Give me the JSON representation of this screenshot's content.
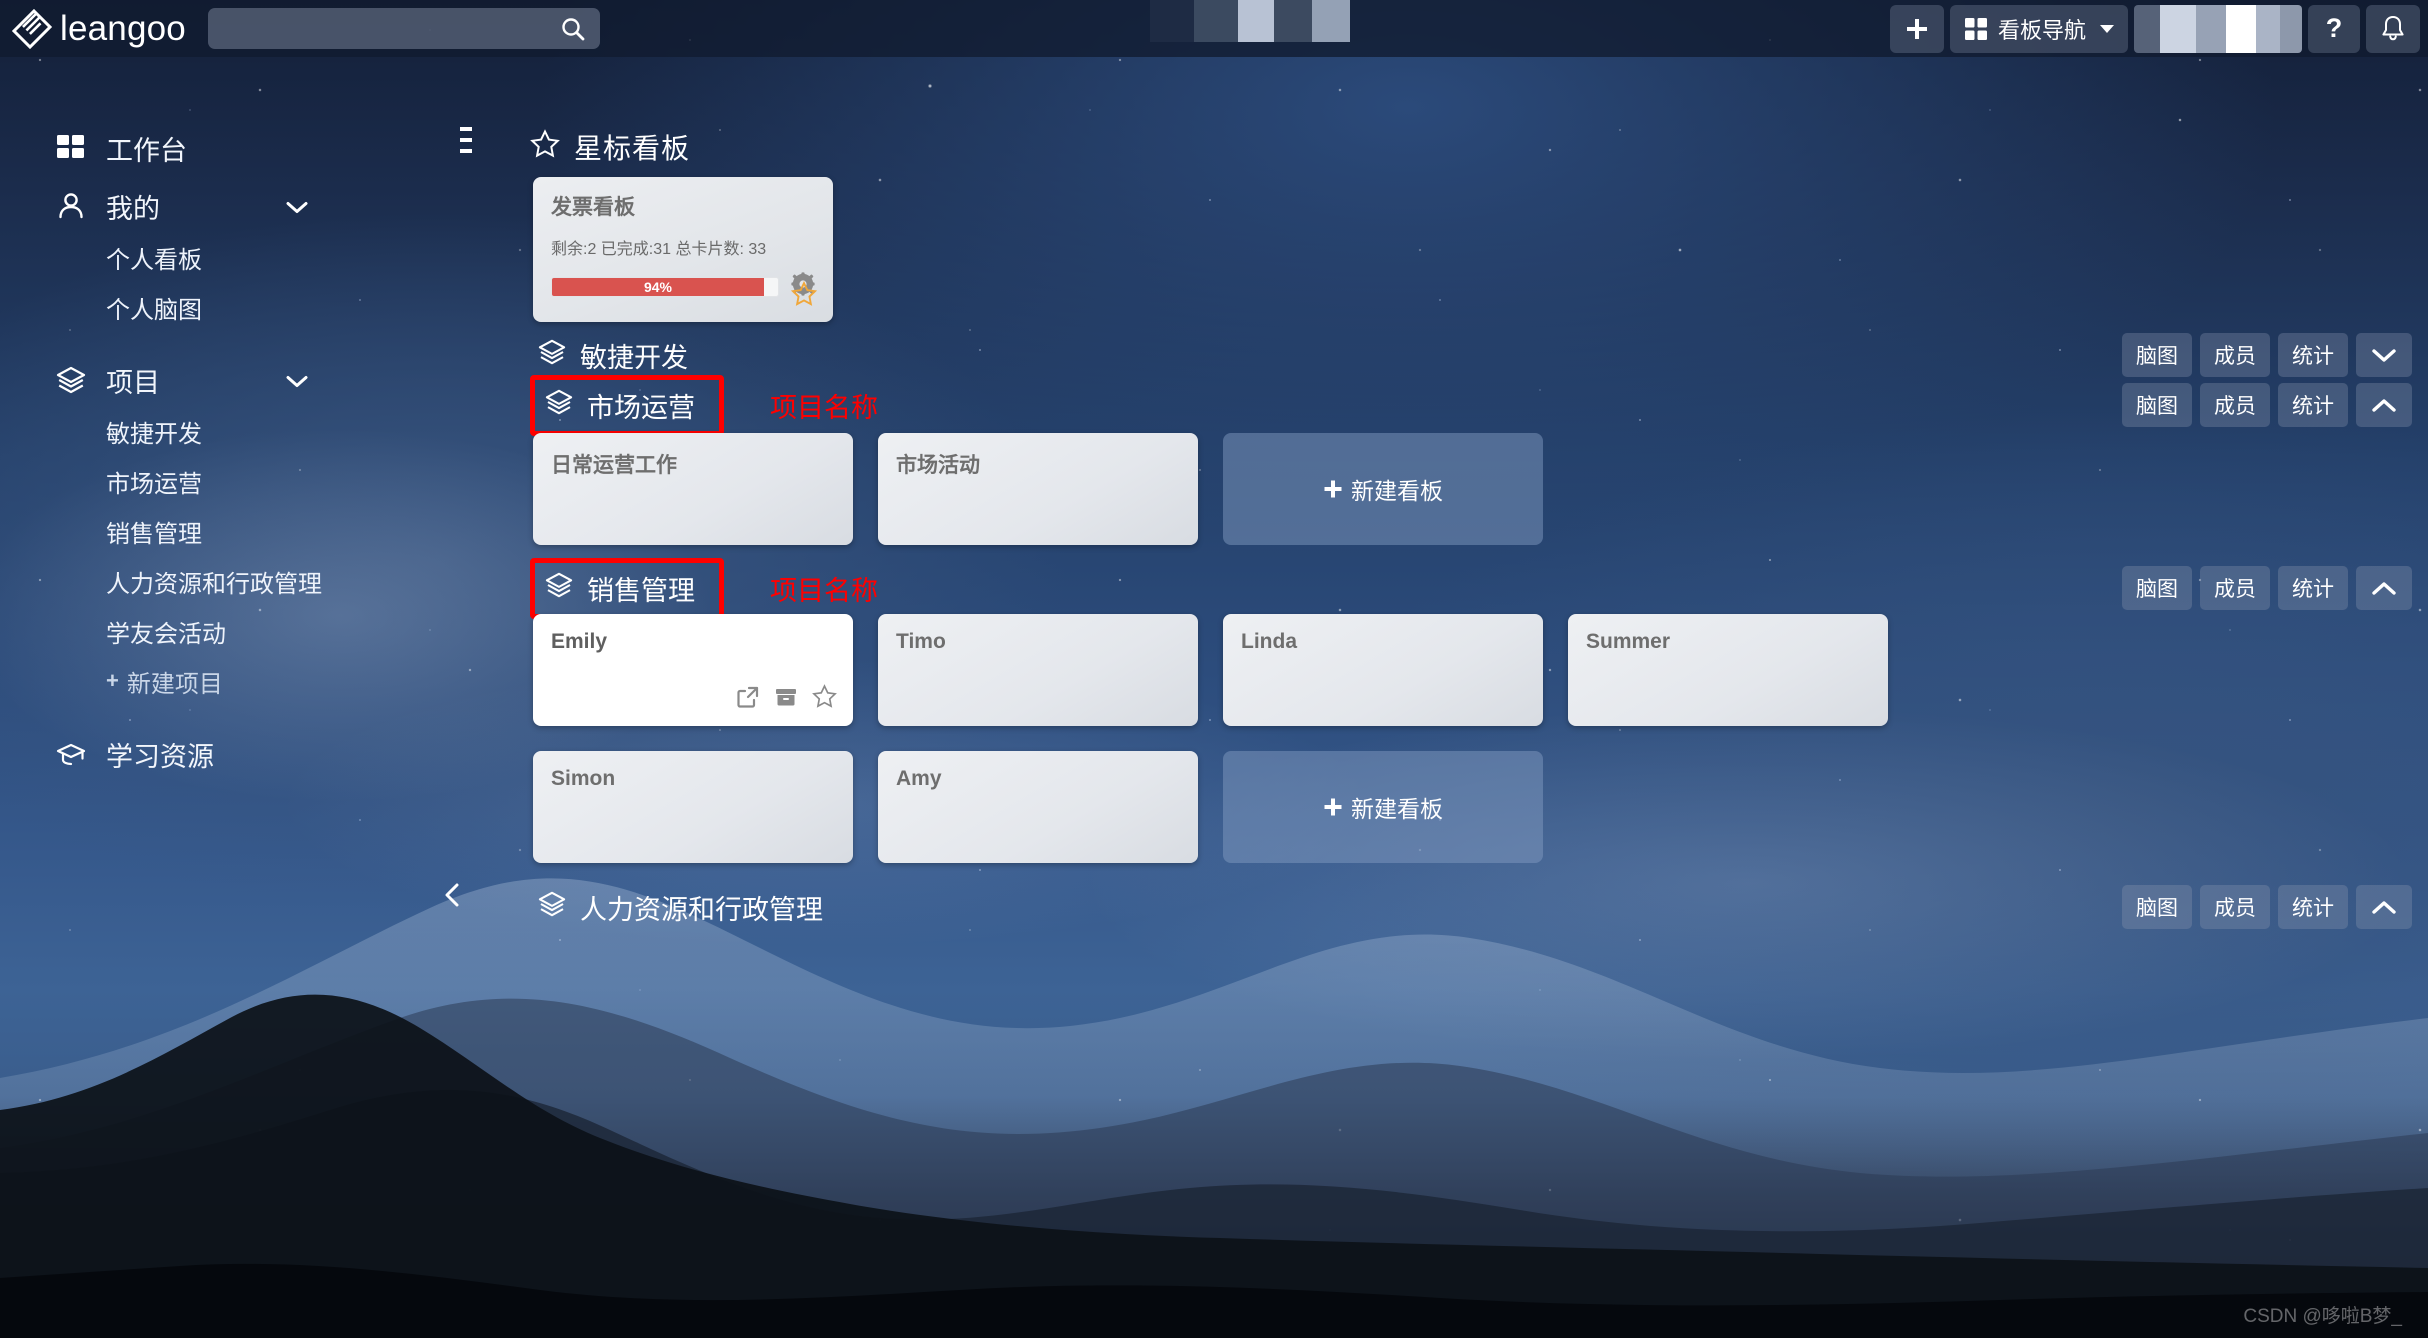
{
  "header": {
    "logo_text": "leangoo",
    "logo_icon": "leangoo-diamond-logo",
    "search_placeholder": "",
    "search_value": "",
    "search_icon": "search-icon",
    "add_button_label": "+",
    "apps_icon": "grid-apps-icon",
    "board_nav_label": "看板导航",
    "help_label": "?",
    "bell_icon": "bell-notification-icon"
  },
  "sidebar": {
    "workbench": {
      "label": "工作台",
      "icon": "grid-dashboard-icon"
    },
    "mine": {
      "label": "我的",
      "icon": "person-icon",
      "chevron": "chevron-down-icon"
    },
    "mine_children": [
      {
        "label": "个人看板"
      },
      {
        "label": "个人脑图"
      }
    ],
    "projects": {
      "label": "项目",
      "icon": "layers-icon",
      "chevron": "chevron-down-icon"
    },
    "project_children": [
      {
        "label": "敏捷开发"
      },
      {
        "label": "市场运营"
      },
      {
        "label": "销售管理"
      },
      {
        "label": "人力资源和行政管理"
      },
      {
        "label": "学友会活动"
      }
    ],
    "new_project": {
      "label": "新建项目",
      "plus": "+"
    },
    "learning": {
      "label": "学习资源",
      "icon": "graduation-cap-icon"
    },
    "collapse_icon": "chevron-left-icon"
  },
  "main": {
    "hamburger_icon": "collapse-menu-icon",
    "starred": {
      "star_icon": "star-outline-icon",
      "title": "星标看板",
      "card": {
        "name": "发票看板",
        "stats": "剩余:2  已完成:31  总卡片数: 33",
        "progress_text": "94%",
        "progress_percent": 94,
        "progress_color": "#d9534f",
        "gear_icon": "gear-settings-icon",
        "star_icon": "star-filled-outline-icon"
      }
    },
    "action_labels": {
      "mindmap": "脑图",
      "members": "成员",
      "stats": "统计"
    },
    "annotation_text": "项目名称",
    "annotation_color": "#ff0000",
    "new_board_label": "新建看板",
    "card_icons": {
      "open": "external-link-icon",
      "archive": "archive-box-icon",
      "star": "star-outline-icon"
    },
    "projects": [
      {
        "name": "敏捷开发",
        "icon": "layers-icon",
        "boxed": false,
        "annotated": false,
        "collapsed": true,
        "toggle_icon": "chevron-down-icon",
        "boards": []
      },
      {
        "name": "市场运营",
        "icon": "layers-icon",
        "boxed": true,
        "annotated": true,
        "collapsed": false,
        "toggle_icon": "chevron-up-icon",
        "boards": [
          {
            "name": "日常运营工作",
            "style": "grey"
          },
          {
            "name": "市场活动",
            "style": "grey"
          }
        ]
      },
      {
        "name": "销售管理",
        "icon": "layers-icon",
        "boxed": true,
        "annotated": true,
        "collapsed": false,
        "toggle_icon": "chevron-up-icon",
        "boards": [
          {
            "name": "Emily",
            "style": "white",
            "hovered": true
          },
          {
            "name": "Timo",
            "style": "grey"
          },
          {
            "name": "Linda",
            "style": "grey"
          },
          {
            "name": "Summer",
            "style": "grey"
          },
          {
            "name": "Simon",
            "style": "grey"
          },
          {
            "name": "Amy",
            "style": "grey"
          }
        ]
      },
      {
        "name": "人力资源和行政管理",
        "icon": "layers-icon",
        "boxed": false,
        "annotated": false,
        "collapsed": true,
        "toggle_icon": "chevron-down-icon",
        "boards": []
      }
    ]
  },
  "watermark": "CSDN @哆啦B梦_"
}
